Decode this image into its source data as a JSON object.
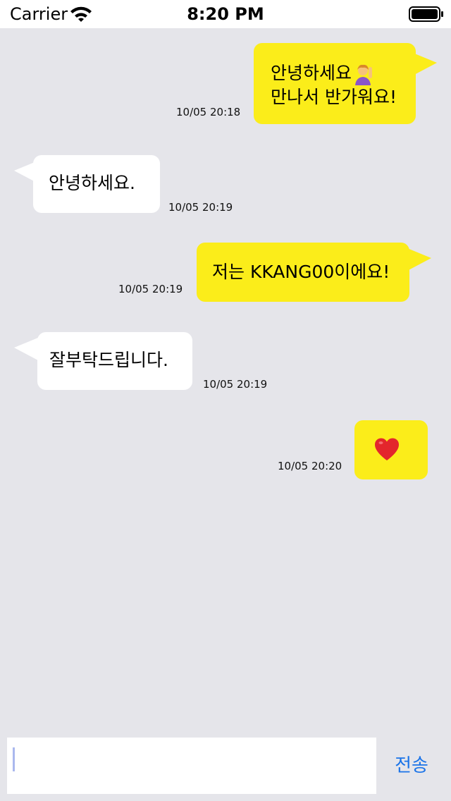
{
  "status_bar": {
    "carrier": "Carrier",
    "time": "8:20 PM",
    "wifi_icon": "wifi-icon",
    "battery_icon": "battery-full-icon"
  },
  "colors": {
    "sent_bubble": "#fbed1a",
    "received_bubble": "#ffffff",
    "background": "#e5e5ea",
    "send_button": "#1a73e8"
  },
  "messages": [
    {
      "direction": "sent",
      "lines": [
        "안녕하세요",
        "만나서 반가워요!"
      ],
      "emoji_icon": "person-raising-hand-emoji",
      "timestamp": "10/05 20:18"
    },
    {
      "direction": "received",
      "lines": [
        "안녕하세요."
      ],
      "timestamp": "10/05 20:19"
    },
    {
      "direction": "sent",
      "lines": [
        "저는 KKANG00이에요!"
      ],
      "timestamp": "10/05 20:19"
    },
    {
      "direction": "received",
      "lines": [
        "잘부탁드립니다."
      ],
      "timestamp": "10/05 20:19"
    },
    {
      "direction": "sent",
      "lines": [],
      "emoji_icon": "red-heart-emoji",
      "timestamp": "10/05 20:20"
    }
  ],
  "input_bar": {
    "text_value": "",
    "send_label": "전송"
  }
}
